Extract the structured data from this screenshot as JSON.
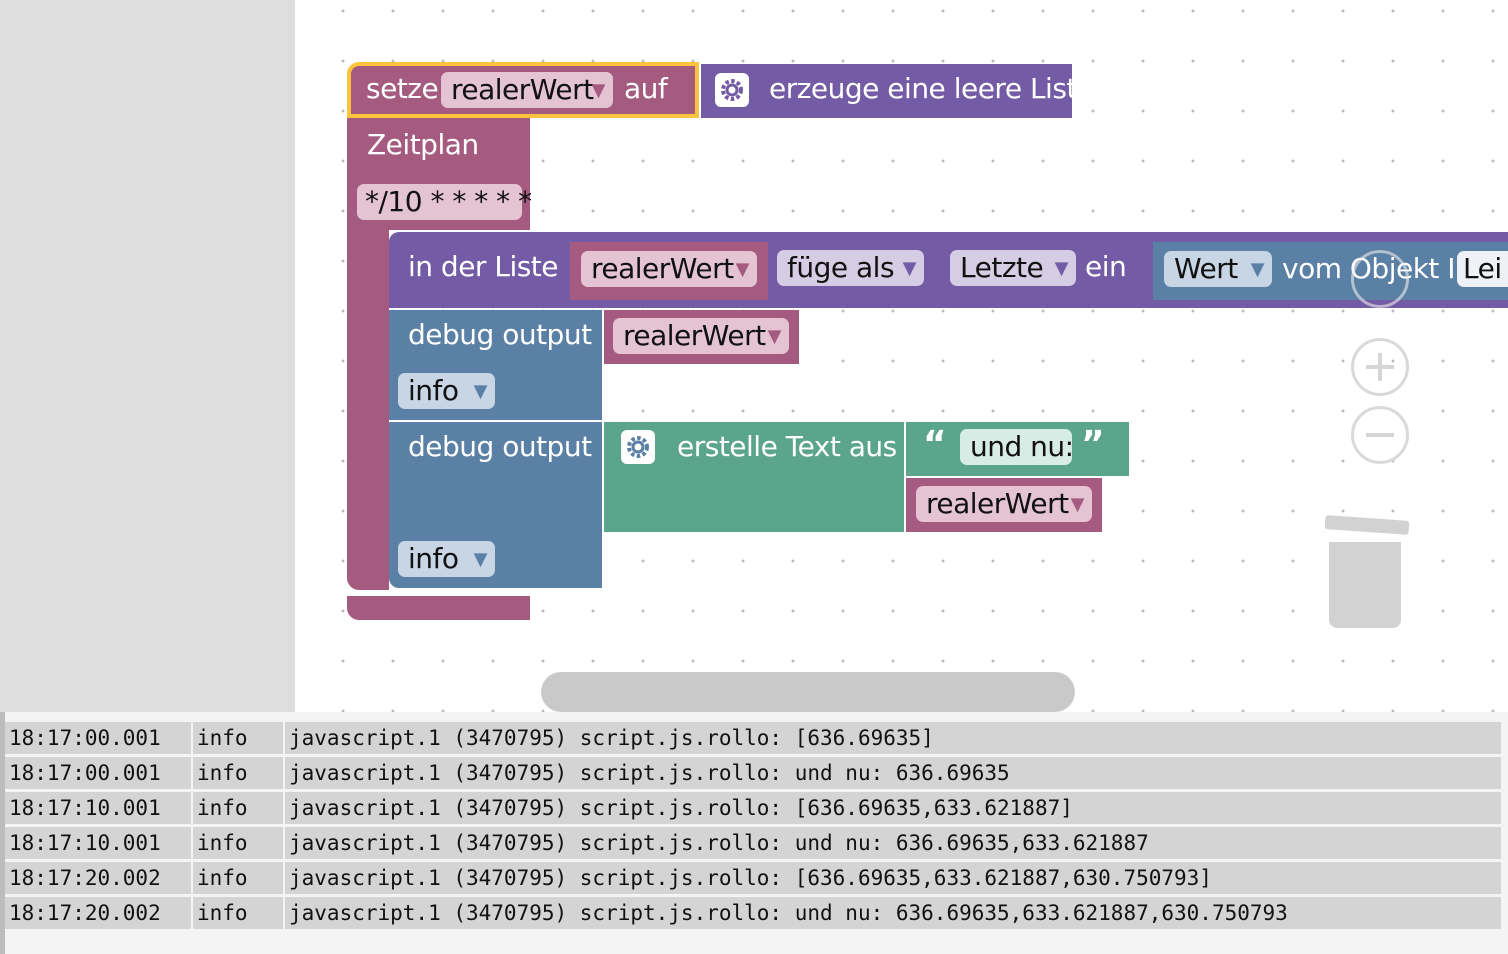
{
  "workspace": {
    "setze_block": {
      "label_setze": "setze",
      "variable": "realerWert",
      "label_auf": "auf",
      "create_list": "erzeuge eine leere Liste"
    },
    "schedule_block": {
      "label": "Zeitplan",
      "cron": "*/10 * * * * *"
    },
    "list_block": {
      "label_in_list": "in der Liste",
      "variable": "realerWert",
      "insert_mode": "füge als",
      "position": "Letzte",
      "label_ein": "ein",
      "value_type": "Wert",
      "label_object": "vom Objekt ID",
      "object_id_partial": "Lei"
    },
    "debug1": {
      "label": "debug output",
      "variable": "realerWert",
      "level": "info"
    },
    "debug2": {
      "label": "debug output",
      "create_text": "erstelle Text aus",
      "open_quote": "“",
      "text": "und nu:",
      "close_quote": "”",
      "variable": "realerWert",
      "level": "info"
    },
    "dropdown_arrow": "▼"
  },
  "colors": {
    "variables": "#a55b80",
    "lists": "#745ba5",
    "text": "#5ba58c",
    "debug": "#5b80a5",
    "selected_outline": "#fcc33f"
  },
  "log": {
    "rows": [
      {
        "time": "18:17:00.001",
        "level": "info",
        "message": "javascript.1 (3470795) script.js.rollo: [636.69635]"
      },
      {
        "time": "18:17:00.001",
        "level": "info",
        "message": "javascript.1 (3470795) script.js.rollo: und nu: 636.69635"
      },
      {
        "time": "18:17:10.001",
        "level": "info",
        "message": "javascript.1 (3470795) script.js.rollo: [636.69635,633.621887]"
      },
      {
        "time": "18:17:10.001",
        "level": "info",
        "message": "javascript.1 (3470795) script.js.rollo: und nu: 636.69635,633.621887"
      },
      {
        "time": "18:17:20.002",
        "level": "info",
        "message": "javascript.1 (3470795) script.js.rollo: [636.69635,633.621887,630.750793]"
      },
      {
        "time": "18:17:20.002",
        "level": "info",
        "message": "javascript.1 (3470795) script.js.rollo: und nu: 636.69635,633.621887,630.750793"
      }
    ]
  },
  "icons": [
    "gear-icon",
    "zoom-in-icon",
    "zoom-out-icon",
    "trash-icon",
    "recenter-icon"
  ]
}
